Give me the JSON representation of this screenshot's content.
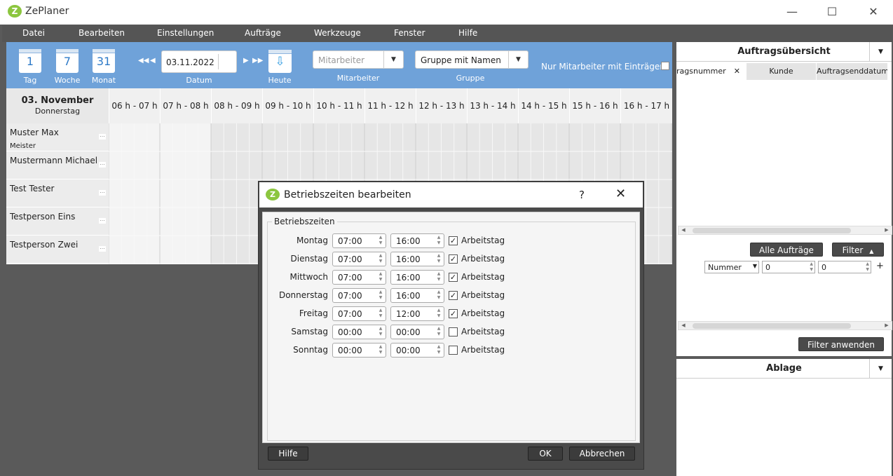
{
  "app": {
    "logo_letter": "Z",
    "title": "ZePlaner"
  },
  "window_controls": {
    "minimize": "—",
    "maximize": "☐",
    "close": "✕"
  },
  "menu": [
    "Datei",
    "Bearbeiten",
    "Einstellungen",
    "Aufträge",
    "Werkzeuge",
    "Fenster",
    "Hilfe"
  ],
  "toolbar": {
    "day": {
      "num": "1",
      "label": "Tag"
    },
    "week": {
      "num": "7",
      "label": "Woche"
    },
    "month": {
      "num": "31",
      "label": "Monat"
    },
    "date_value": "03.11.2022",
    "date_label": "Datum",
    "today_label": "Heute",
    "employee_placeholder": "Mitarbeiter",
    "employee_label": "Mitarbeiter",
    "group_value": "Gruppe mit Namen",
    "group_label": "Gruppe",
    "only_with_entries": "Nur Mitarbeiter mit Einträgen"
  },
  "schedule": {
    "day_title": "03. November",
    "weekday": "Donnerstag",
    "hours": [
      "06 h - 07 h",
      "07 h - 08 h",
      "08 h - 09 h",
      "09 h - 10 h",
      "10 h - 11 h",
      "11 h - 12 h",
      "12 h - 13 h",
      "13 h - 14 h",
      "14 h - 15 h",
      "15 h - 16 h",
      "16 h - 17 h"
    ],
    "employees": [
      {
        "name": "Muster Max",
        "role": "Meister"
      },
      {
        "name": "Mustermann Michael",
        "role": ""
      },
      {
        "name": "Test Tester",
        "role": ""
      },
      {
        "name": "Testperson Eins",
        "role": ""
      },
      {
        "name": "Testperson Zwei",
        "role": ""
      }
    ]
  },
  "right_panel": {
    "orders_title": "Auftragsübersicht",
    "columns": [
      "ragsnummer",
      "Kunde",
      "Auftragsenddatum"
    ],
    "all_orders": "Alle Aufträge",
    "filter": "Filter",
    "filter_field": "Nummer",
    "filter_from": "0",
    "filter_to": "0",
    "apply_filter": "Filter anwenden",
    "storage_title": "Ablage"
  },
  "dialog": {
    "logo_letter": "Z",
    "title": "Betriebszeiten bearbeiten",
    "help_char": "?",
    "group_title": "Betriebszeiten",
    "checkbox_label": "Arbeitstag",
    "days": [
      {
        "day": "Montag",
        "from": "07:00",
        "to": "16:00",
        "workday": true
      },
      {
        "day": "Dienstag",
        "from": "07:00",
        "to": "16:00",
        "workday": true
      },
      {
        "day": "Mittwoch",
        "from": "07:00",
        "to": "16:00",
        "workday": true
      },
      {
        "day": "Donnerstag",
        "from": "07:00",
        "to": "16:00",
        "workday": true
      },
      {
        "day": "Freitag",
        "from": "07:00",
        "to": "12:00",
        "workday": true
      },
      {
        "day": "Samstag",
        "from": "00:00",
        "to": "00:00",
        "workday": false
      },
      {
        "day": "Sonntag",
        "from": "00:00",
        "to": "00:00",
        "workday": false
      }
    ],
    "help_button": "Hilfe",
    "ok_button": "OK",
    "cancel_button": "Abbrechen"
  },
  "colors": {
    "toolbar_blue": "#6fa2d9",
    "logo_green": "#8cc63f",
    "dark_bg": "#5a5a5a"
  }
}
